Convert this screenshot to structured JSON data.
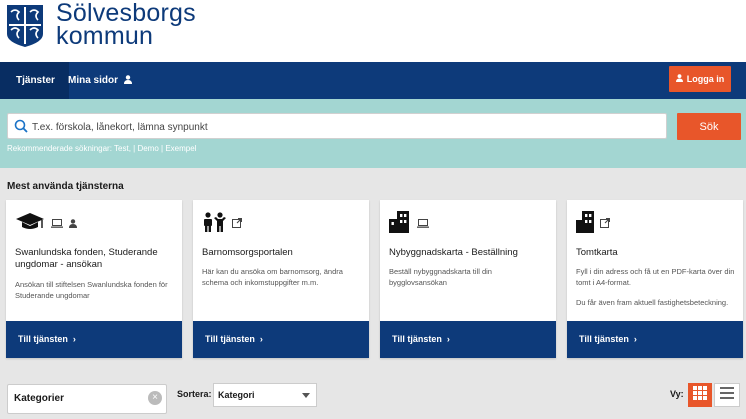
{
  "brand": {
    "line1": "Sölvesborgs",
    "line2": "kommun",
    "color": "#0d3a7a"
  },
  "nav": {
    "items": [
      {
        "label": "Tjänster",
        "active": true
      },
      {
        "label": "Mina sidor",
        "icon": "user-icon"
      }
    ],
    "login_label": "Logga in"
  },
  "search": {
    "placeholder": "T.ex. förskola, lånekort, lämna synpunkt",
    "button_label": "Sök",
    "recommended_prefix": "Rekommenderade sökningar:",
    "recommended": [
      "Test",
      "Demo",
      "Exempel"
    ]
  },
  "section_title": "Mest använda tjänsterna",
  "cards": [
    {
      "icons": [
        "graduation-cap-icon",
        "computer-icon",
        "person-icon"
      ],
      "title": "Swanlundska fonden, Studerande ungdomar - ansökan",
      "description": "Ansökan till stiftelsen Swanlundska fonden för Studerande ungdomar",
      "description2": "",
      "cta": "Till tjänsten"
    },
    {
      "icons": [
        "children-icon",
        "external-link-icon"
      ],
      "title": "Barnomsorgsportalen",
      "description": "Här kan du ansöka om barnomsorg, ändra schema och inkomstuppgifter m.m.",
      "description2": "",
      "cta": "Till tjänsten"
    },
    {
      "icons": [
        "buildings-icon",
        "computer-icon"
      ],
      "title": "Nybyggnadskarta - Beställning",
      "description": "Beställ nybyggnadskarta till din bygglovsansökan",
      "description2": "",
      "cta": "Till tjänsten"
    },
    {
      "icons": [
        "building-icon",
        "external-link-icon"
      ],
      "title": "Tomtkarta",
      "description": "Fyll i din adress och få ut en PDF-karta över din tomt i A4-format.",
      "description2": "Du får även fram aktuell fastighetsbeteckning.",
      "cta": "Till tjänsten"
    }
  ],
  "filters": {
    "categories_label": "Kategorier",
    "sort_label": "Sortera:",
    "sort_value": "Kategori",
    "view_label": "Vy:"
  },
  "colors": {
    "nav": "#0d3a7a",
    "accent": "#e8562a",
    "search_band": "#a3d6d2"
  }
}
